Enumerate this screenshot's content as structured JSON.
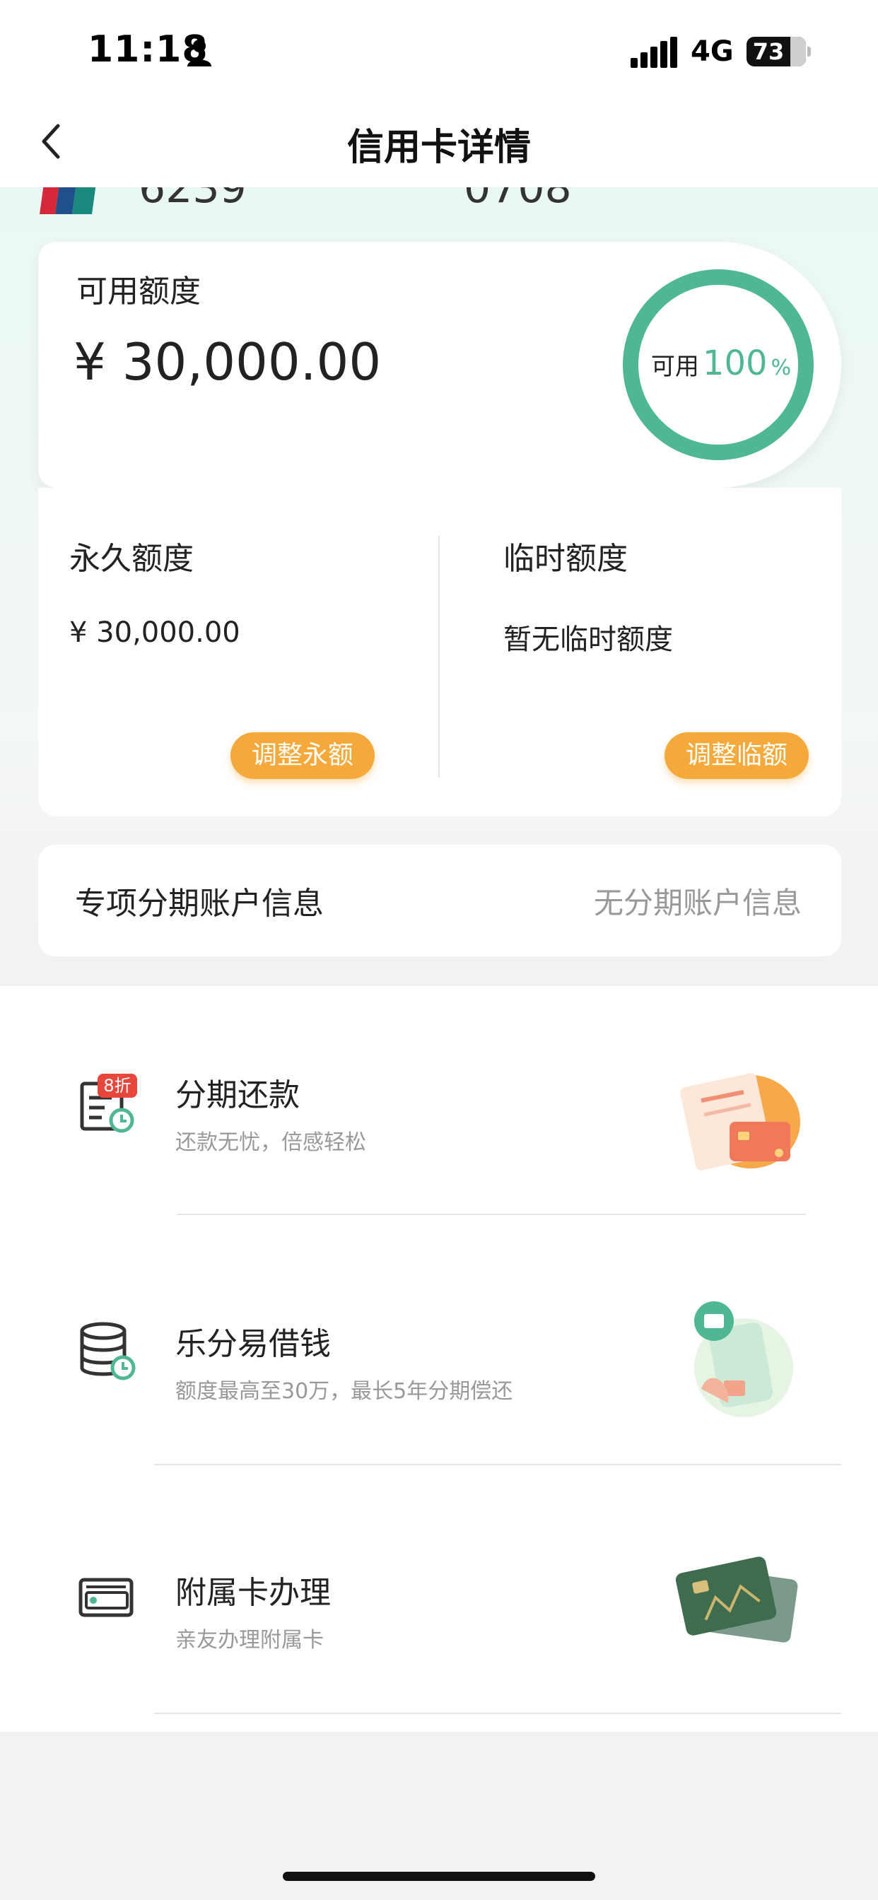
{
  "status_bar": {
    "time": "11:18",
    "network": "4G",
    "battery": "73"
  },
  "nav": {
    "title": "信用卡详情"
  },
  "card": {
    "number_left": "6239",
    "number_right": "0708"
  },
  "available": {
    "label": "可用额度",
    "amount": "¥ 30,000.00",
    "ring_label": "可用",
    "ring_value": "100",
    "ring_unit": "%",
    "percent": 100
  },
  "quota": {
    "permanent_label": "永久额度",
    "permanent_value": "¥ 30,000.00",
    "permanent_button": "调整永额",
    "temporary_label": "临时额度",
    "temporary_value": "暂无临时额度",
    "temporary_button": "调整临额"
  },
  "installment_account": {
    "label": "专项分期账户信息",
    "value": "无分期账户信息"
  },
  "services": [
    {
      "title": "分期还款",
      "subtitle": "还款无忧，倍感轻松",
      "badge": "8折",
      "icon": "installment-doc-icon"
    },
    {
      "title": "乐分易借钱",
      "subtitle": "额度最高至30万，最长5年分期偿还",
      "icon": "coin-stack-clock-icon"
    },
    {
      "title": "附属卡办理",
      "subtitle": "亲友办理附属卡",
      "icon": "card-icon"
    }
  ],
  "colors": {
    "accent_green": "#4fb892",
    "button_orange": "#f5a93a"
  }
}
